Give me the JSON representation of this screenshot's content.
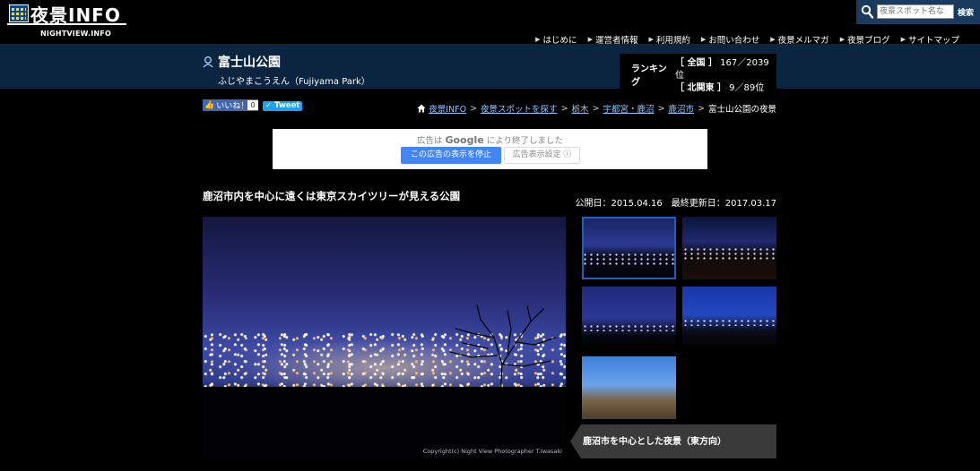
{
  "site": {
    "logo_title": "夜景INFO",
    "logo_subtitle": "NIGHTVIEW.INFO"
  },
  "search": {
    "placeholder": "夜景スポット名な",
    "button_label": "検索",
    "icon": "search-icon"
  },
  "global_nav": [
    {
      "label": "はじめに"
    },
    {
      "label": "運営者情報"
    },
    {
      "label": "利用規約"
    },
    {
      "label": "お問い合わせ"
    },
    {
      "label": "夜景メルマガ"
    },
    {
      "label": "夜景ブログ"
    },
    {
      "label": "サイトマップ"
    }
  ],
  "spot": {
    "title": "富士山公園",
    "reading": "ふじやまこうえん（Fujiyama Park）",
    "icon": "location-pin-icon"
  },
  "ranking": {
    "label": "ランキング",
    "rows": [
      {
        "name": "［ 全国 ］",
        "value": "167／2039位"
      },
      {
        "name": "［ 北関東 ］",
        "value": "9／89位"
      }
    ]
  },
  "social": {
    "like_label": "いいね！",
    "like_count": "0",
    "tweet_label": "Tweet"
  },
  "breadcrumb": {
    "links": [
      "夜景INFO",
      "夜景スポットを探す",
      "栃木",
      "宇都宮・鹿沼",
      "鹿沼市"
    ],
    "separator": ">",
    "current": "富士山公園の夜景"
  },
  "ad": {
    "closed_prefix": "広告は",
    "closed_brand": "Google",
    "closed_suffix": "により終了しました",
    "stop_label": "この広告の表示を停止",
    "settings_label": "広告表示設定 ⓘ"
  },
  "content": {
    "catchphrase": "鹿沼市内を中心に遠くは東京スカイツリーが見える公園",
    "dates": "公開日：2015.04.16　最終更新日：2017.03.17"
  },
  "photo": {
    "credit": "Copyright(c) Night View Photographer T.Iwasaki",
    "caption": "鹿沼市を中心とした夜景（東方向）"
  },
  "colors": {
    "band_bg": "#0b2540",
    "search_bg": "#1b3b5e",
    "link": "#8ec5ff",
    "thumb_active": "#1e5fc2"
  }
}
